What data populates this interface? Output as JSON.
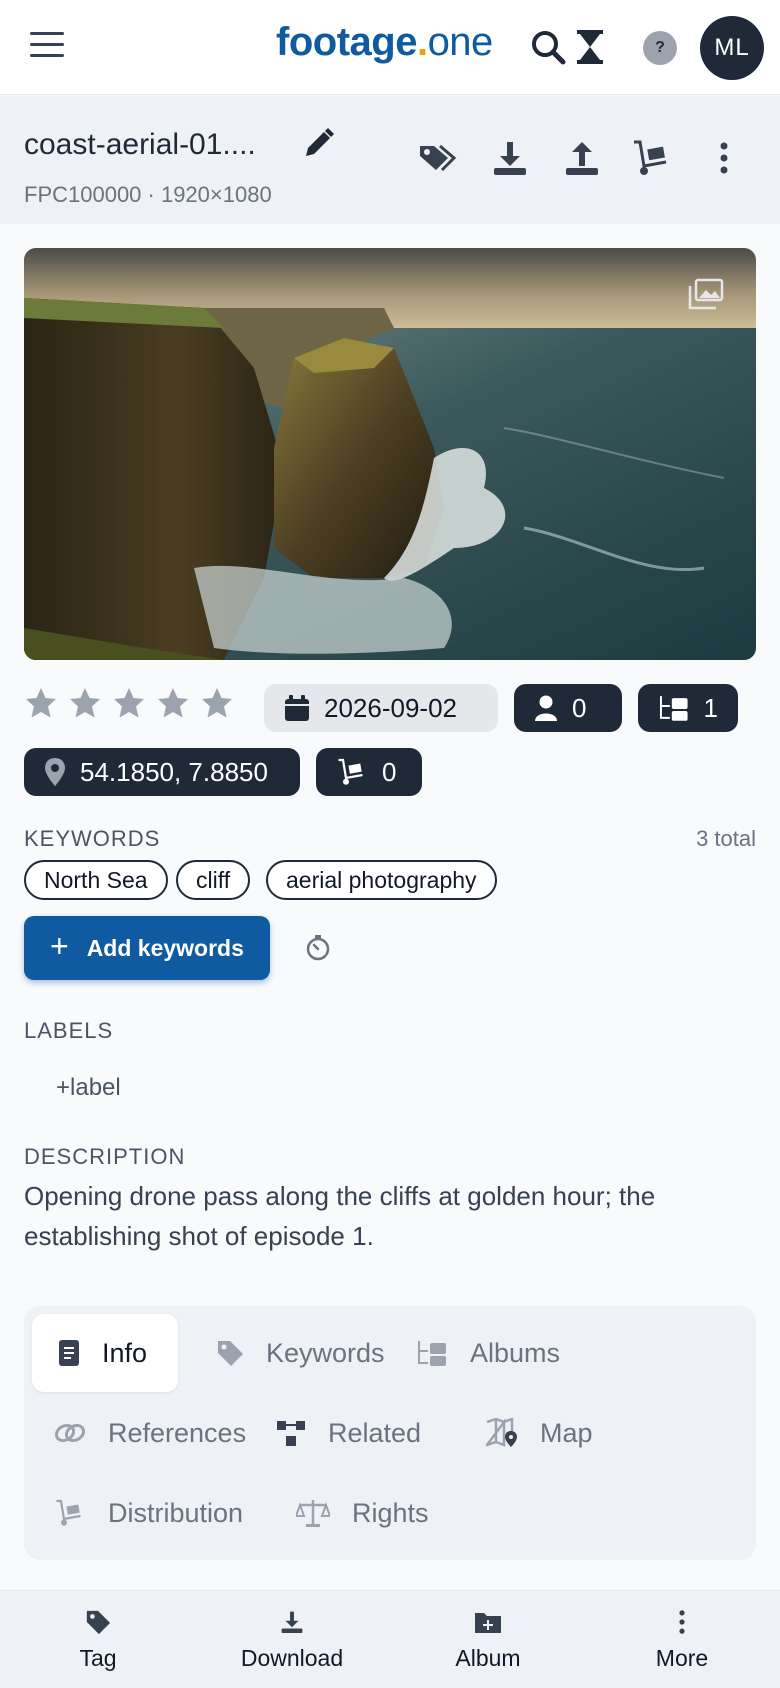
{
  "app": {
    "logo_part1": "footage",
    "logo_dot": ".",
    "logo_part2": "one",
    "help_label": "?",
    "avatar_initials": "ML"
  },
  "file": {
    "title": "coast-aerial-01....",
    "meta": "FPC100000 · 1920×1080"
  },
  "rating": {
    "stars": 5,
    "filled": 0
  },
  "chips": {
    "date": "2026-09-02",
    "people_count": "0",
    "albums_count": "1",
    "location": "54.1850, 7.8850",
    "distribution_count": "0"
  },
  "keywords": {
    "heading": "KEYWORDS",
    "total": "3 total",
    "items": [
      "North Sea",
      "cliff",
      "aerial photography"
    ],
    "add_button": "Add keywords",
    "add_plus": "+"
  },
  "labels": {
    "heading": "LABELS",
    "add_label": "+label"
  },
  "description": {
    "heading": "DESCRIPTION",
    "text": " Opening drone pass along the cliffs at golden hour; the establishing shot of episode 1."
  },
  "tabs": {
    "info": "Info",
    "keywords": "Keywords",
    "albums": "Albums",
    "references": "References",
    "related": "Related",
    "map": "Map",
    "distribution": "Distribution",
    "rights": "Rights",
    "active": "Info"
  },
  "bottom_bar": {
    "tag": "Tag",
    "download": "Download",
    "album": "Album",
    "more": "More"
  },
  "colors": {
    "brand_blue": "#0f5aa0",
    "brand_dot": "#f59e0b",
    "dark_chip": "#1f2937",
    "star_gray": "#9ca3af"
  },
  "icons": [
    "menu-icon",
    "search-icon",
    "hourglass-icon",
    "help-icon",
    "pencil-icon",
    "tag-icon",
    "download-icon",
    "upload-icon",
    "cart-icon",
    "more-vertical-icon",
    "gallery-icon",
    "star-icon",
    "calendar-icon",
    "person-icon",
    "folder-tree-icon",
    "location-pin-icon",
    "timer-icon",
    "document-icon",
    "link-icon",
    "related-icon",
    "map-icon",
    "scale-icon",
    "folder-plus-icon"
  ]
}
